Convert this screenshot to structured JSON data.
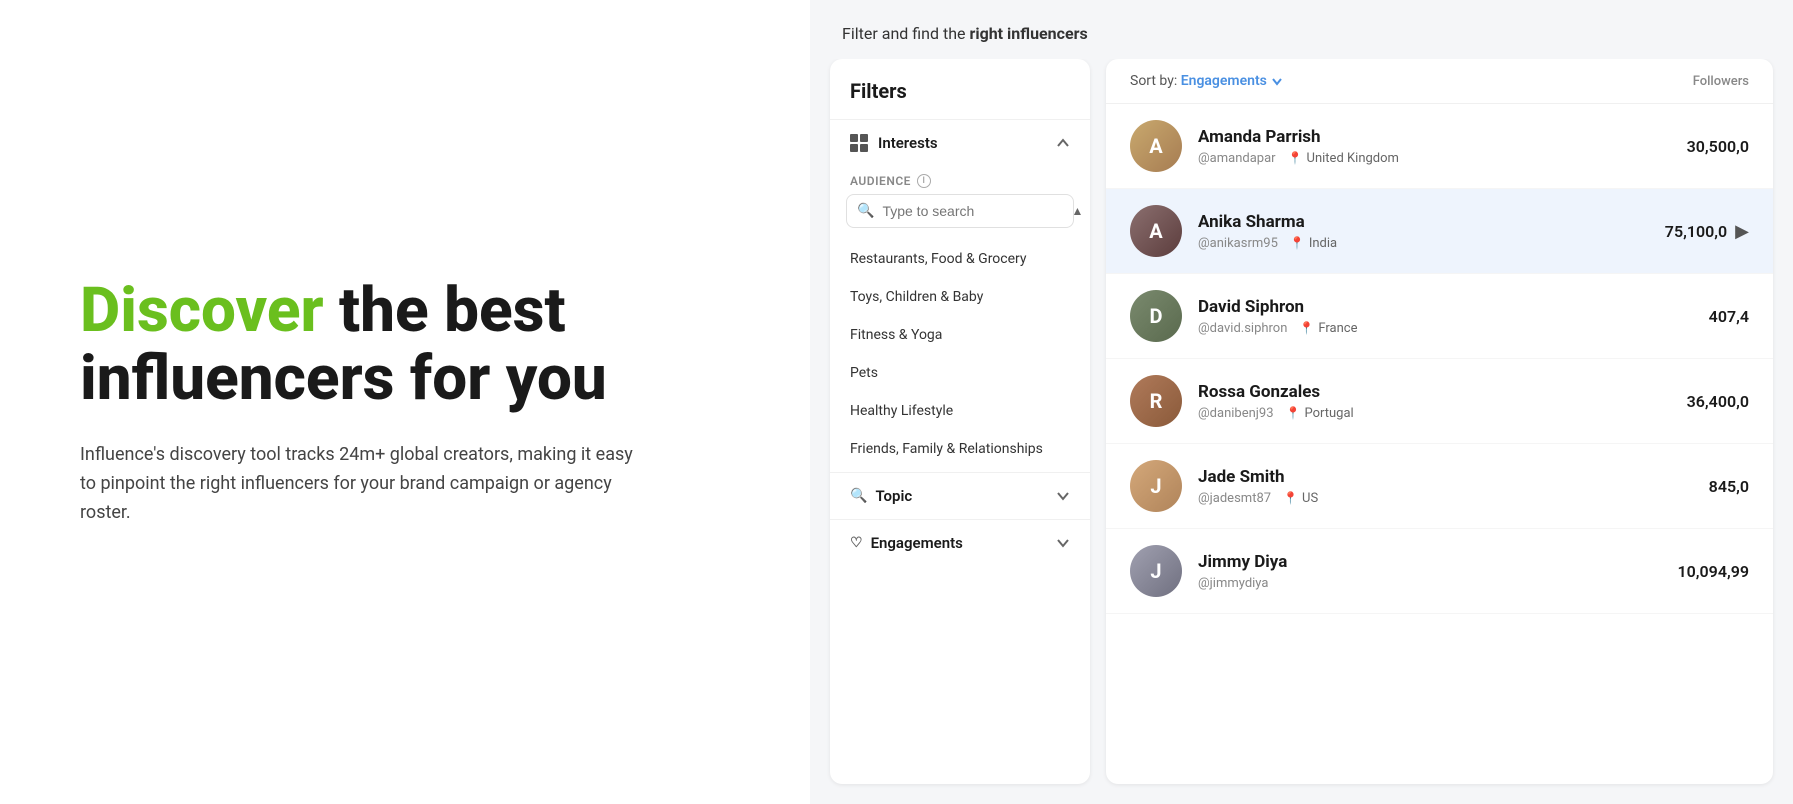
{
  "page": {
    "hero": {
      "title_green": "Discover",
      "title_rest": " the best influencers for you",
      "subtitle": "Influence's discovery tool tracks 24m+ global creators, making it easy to pinpoint the right influencers for your brand campaign or agency roster."
    },
    "topbar": {
      "text": "Filter and find the ",
      "bold": "right influencers"
    },
    "filters": {
      "title": "Filters",
      "interests": {
        "label": "Interests",
        "audience_label": "AUDIENCE",
        "search_placeholder": "Type to search",
        "items": [
          "Restaurants, Food & Grocery",
          "Toys, Children & Baby",
          "Fitness & Yoga",
          "Pets",
          "Healthy Lifestyle",
          "Friends, Family & Relationships"
        ]
      },
      "topic": {
        "label": "Topic"
      },
      "engagements": {
        "label": "Engagements"
      }
    },
    "list": {
      "sort_by_label": "Sort by:",
      "sort_by_value": "Engagements",
      "followers_label": "Followers",
      "influencers": [
        {
          "name": "Amanda Parrish",
          "handle": "@amandapar",
          "location": "United Kingdom",
          "followers": "30,500,0",
          "highlighted": false,
          "color": "amanda"
        },
        {
          "name": "Anika Sharma",
          "handle": "@anikasrm95",
          "location": "India",
          "followers": "75,100,0",
          "highlighted": true,
          "color": "anika"
        },
        {
          "name": "David Siphron",
          "handle": "@david.siphron",
          "location": "France",
          "followers": "407,4",
          "highlighted": false,
          "color": "david"
        },
        {
          "name": "Rossa Gonzales",
          "handle": "@danibenj93",
          "location": "Portugal",
          "followers": "36,400,0",
          "highlighted": false,
          "color": "rossa"
        },
        {
          "name": "Jade Smith",
          "handle": "@jadesmt87",
          "location": "US",
          "followers": "845,0",
          "highlighted": false,
          "color": "jade"
        },
        {
          "name": "Jimmy Diya",
          "handle": "@jimmydiya",
          "location": "",
          "followers": "10,094,99",
          "highlighted": false,
          "color": "jimmy"
        }
      ]
    }
  }
}
